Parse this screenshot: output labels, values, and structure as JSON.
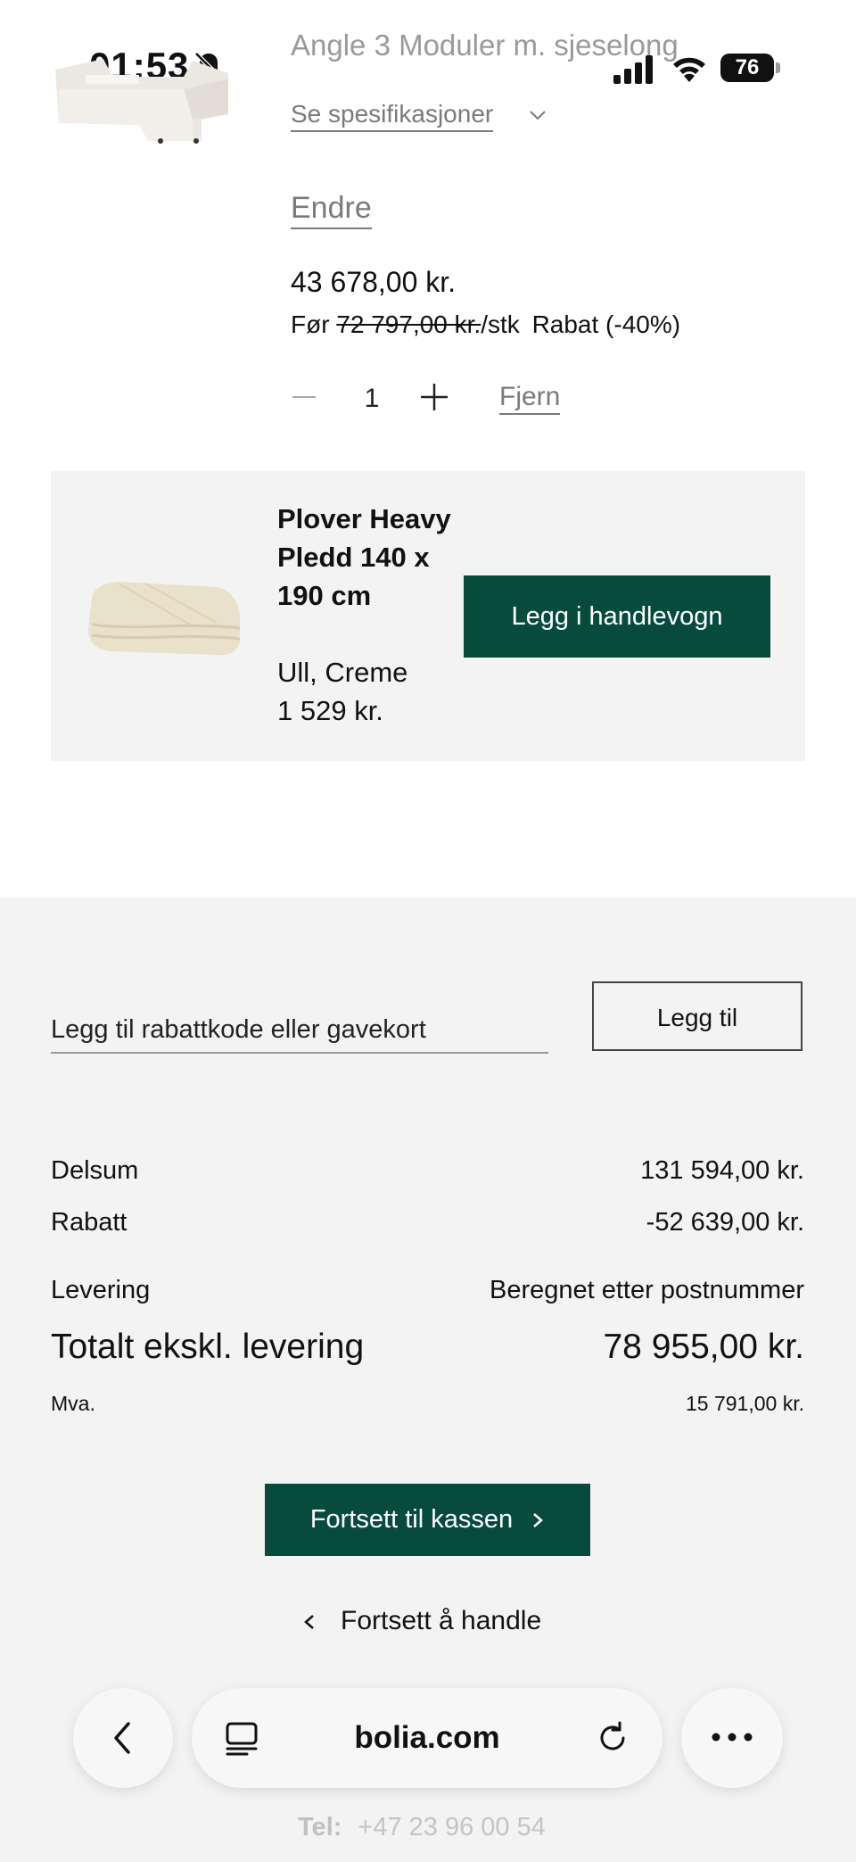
{
  "status_bar": {
    "time": "01:53",
    "battery": "76"
  },
  "cart_item": {
    "name": "Angle 3 Moduler m. sjeselong",
    "spec_link": "Se spesifikasjoner",
    "edit": "Endre",
    "price": "43 678,00 kr.",
    "before_label": "Før",
    "old_price": "72 797,00 kr.",
    "unit": "/stk",
    "discount": "Rabat (-40%)",
    "quantity": "1",
    "remove": "Fjern"
  },
  "upsell": {
    "name": "Plover Heavy Pledd 140 x 190 cm",
    "variant": "Ull, Creme",
    "price": "1 529 kr.",
    "button": "Legg i handlevogn"
  },
  "coupon": {
    "placeholder": "Legg til rabattkode eller gavekort",
    "button": "Legg til"
  },
  "summary": {
    "subtotal_label": "Delsum",
    "subtotal_value": "131 594,00 kr.",
    "discount_label": "Rabatt",
    "discount_value": "-52 639,00 kr.",
    "delivery_label": "Levering",
    "delivery_value": "Beregnet etter postnummer",
    "total_label": "Totalt ekskl. levering",
    "total_value": "78 955,00 kr.",
    "vat_label": "Mva.",
    "vat_value": "15 791,00 kr."
  },
  "actions": {
    "checkout": "Fortsett til kassen",
    "continue_shopping": "Fortsett å handle"
  },
  "browser": {
    "url": "bolia.com"
  },
  "footer": {
    "tel_label": "Tel:",
    "tel_number": "+47 23 96 00 54"
  },
  "colors": {
    "brand_green": "#064b3c",
    "panel_grey": "#f3f3f3"
  }
}
